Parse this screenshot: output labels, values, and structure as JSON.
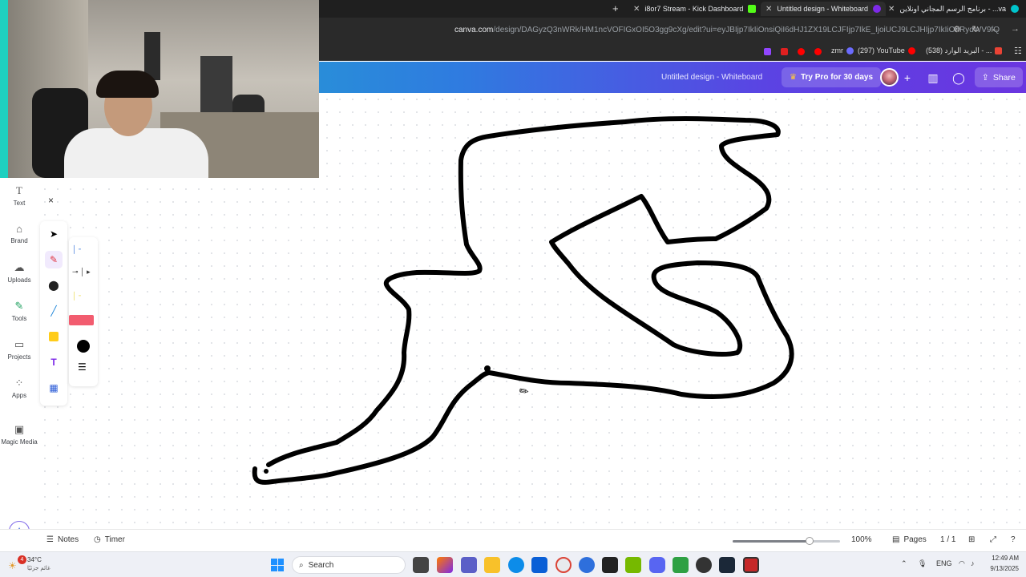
{
  "browser": {
    "tabs": [
      {
        "label": "i8or7 Stream - Kick Dashboard",
        "favicon_color": "#53fc18"
      },
      {
        "label": "Untitled design - Whiteboard",
        "favicon_color": "#7d2ae8"
      },
      {
        "label": "برنامج الرسم المجاني اونلاين - ...va",
        "favicon_color": "#00c4cc"
      }
    ],
    "new_tab": "+",
    "close": "✕",
    "url_domain": "canva.com",
    "url_path": "/design/DAGyzQ3nWRk/HM1ncVOFIGxOI5O3gg9cXg/edit?ui=eyJBIjp7IkIiOnsiQiI6dHJ1ZX19LCJFIjp7IkE_IjoiUCJ9LCJHIjp7IkIiOnRydWV9fQ",
    "bookmarks": [
      {
        "label": "zmr",
        "color": "#e83a3a"
      },
      {
        "label": "(297) YouTube",
        "color": "#ff0000"
      },
      {
        "label": "(538) البريد الوارد - ...",
        "color": "#ea4335"
      }
    ]
  },
  "header": {
    "doc_title": "Untitled design - Whiteboard",
    "try_pro": "Try Pro for 30 days",
    "share": "Share"
  },
  "sidebar": {
    "items": [
      {
        "label": "Text",
        "icon": "text-icon"
      },
      {
        "label": "Brand",
        "icon": "brand-icon"
      },
      {
        "label": "Uploads",
        "icon": "cloud-upload-icon"
      },
      {
        "label": "Tools",
        "icon": "tools-icon"
      },
      {
        "label": "Projects",
        "icon": "folder-icon"
      },
      {
        "label": "Apps",
        "icon": "apps-icon"
      },
      {
        "label": "Magic Media",
        "icon": "magic-media-icon"
      }
    ]
  },
  "draw_panel": {
    "close": "×",
    "tools": [
      "select-icon",
      "pen-icon",
      "shapes-icon",
      "line-icon",
      "sticky-note-icon",
      "text-tool-icon",
      "table-icon"
    ],
    "stroke_color": "#000000",
    "highlighter_color": "#f25c6f"
  },
  "footer": {
    "notes": "Notes",
    "timer": "Timer",
    "zoom": "100%",
    "zoom_level": 0.72,
    "pages": "Pages",
    "page_count": "1 / 1"
  },
  "taskbar": {
    "weather_temp": "34°C",
    "weather_desc": "غائم جزئيًا",
    "notification_count": "4",
    "search": "Search",
    "language": "ENG",
    "time": "12:49 AM",
    "date": "9/13/2025"
  }
}
